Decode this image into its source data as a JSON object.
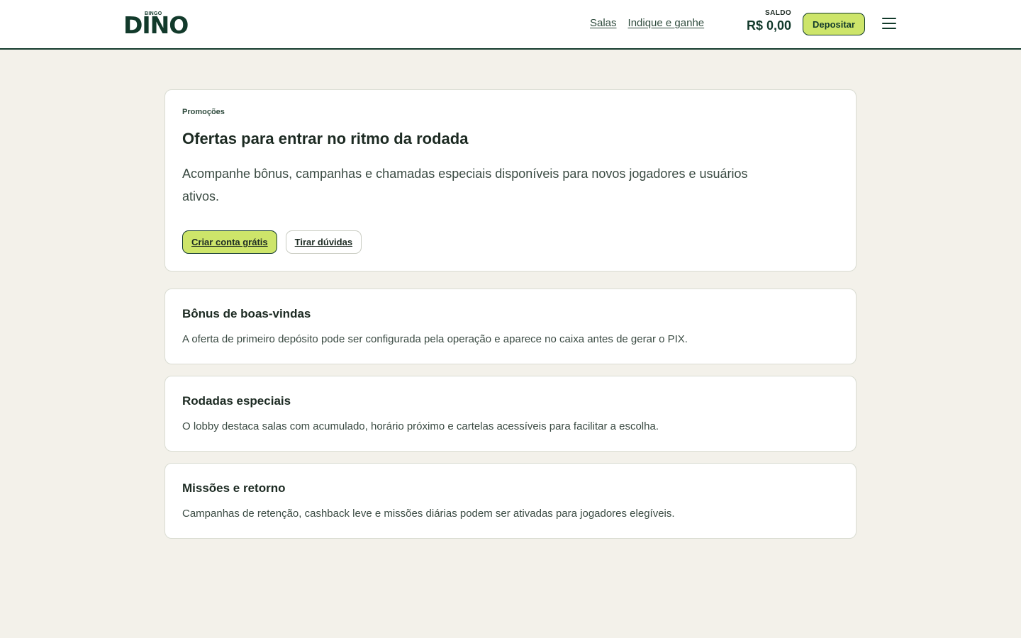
{
  "header": {
    "logo_small": "BINGO",
    "logo_main": "DINO",
    "nav": [
      {
        "label": "Salas"
      },
      {
        "label": "Indique e ganhe"
      }
    ],
    "balance_label": "SALDO",
    "balance_value": "R$ 0,00",
    "deposit_label": "Depositar",
    "menu_icon": "hamburger-menu-icon"
  },
  "hero": {
    "eyebrow": "Promoções",
    "title": "Ofertas para entrar no ritmo da rodada",
    "description": "Acompanhe bônus, campanhas e chamadas especiais disponíveis para novos jogadores e usuários ativos.",
    "primary_button": "Criar conta grátis",
    "secondary_button": "Tirar dúvidas"
  },
  "features": [
    {
      "title": "Bônus de boas-vindas",
      "description": "A oferta de primeiro depósito pode ser configurada pela operação e aparece no caixa antes de gerar o PIX."
    },
    {
      "title": "Rodadas especiais",
      "description": "O lobby destaca salas com acumulado, horário próximo e cartelas acessíveis para facilitar a escolha."
    },
    {
      "title": "Missões e retorno",
      "description": "Campanhas de retenção, cashback leve e missões diárias podem ser ativadas para jogadores elegíveis."
    }
  ],
  "colors": {
    "brand": "#123a2b",
    "accent": "#cde56a",
    "background": "#f3f1ea"
  }
}
